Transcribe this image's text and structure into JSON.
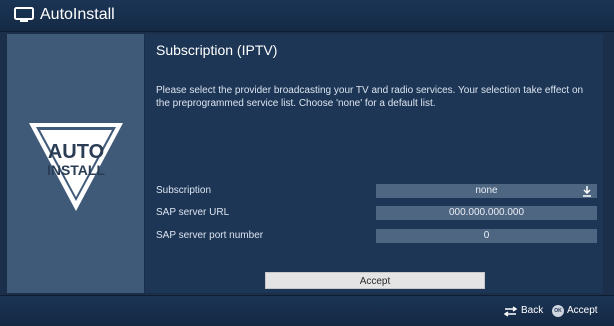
{
  "header": {
    "title": "AutoInstall",
    "icon": "tv-icon"
  },
  "logo": {
    "line1": "AUTO",
    "line2": "INSTALL"
  },
  "main": {
    "title": "Subscription (IPTV)",
    "description": "Please select the provider broadcasting your TV and radio services. Your selection take effect on the preprogrammed service list. Choose 'none' for a default list.",
    "rows": [
      {
        "label": "Subscription",
        "value": "none"
      },
      {
        "label": "SAP server URL",
        "value": "000.000.000.000"
      },
      {
        "label": "SAP server port number",
        "value": "0"
      }
    ],
    "accept_label": "Accept"
  },
  "footer": {
    "back_label": "Back",
    "ok_badge": "OK",
    "accept_label": "Accept"
  },
  "colors": {
    "background": "#1c2f4a",
    "panel": "#1e3656",
    "sidebar": "#3f5a78",
    "field": "#4f6682",
    "button": "#e4e4e4"
  }
}
